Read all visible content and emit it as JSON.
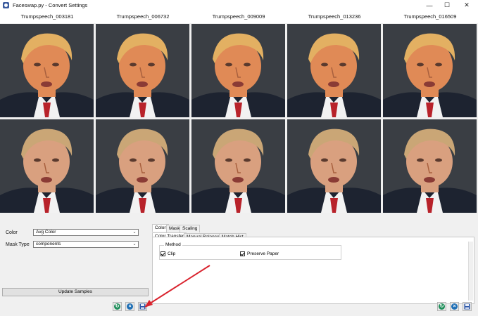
{
  "window": {
    "title": "Faceswap.py - Convert Settings",
    "controls": {
      "minimize": "—",
      "maximize": "☐",
      "close": "✕"
    }
  },
  "columns": [
    "Trumpspeech_003181",
    "Trumpspeech_006732",
    "Trumpspeech_009009",
    "Trumpspeech_013236",
    "Trumpspeech_016509"
  ],
  "grid": {
    "rows": [
      "original-face",
      "swapped-face"
    ],
    "colors": {
      "background": "#3a3e44",
      "suit": "#1d2330",
      "shirt": "#f2f2f2",
      "tie": "#b8222a",
      "hair_original": "#e3b062",
      "hair_swapped": "#caa676",
      "skin_original": "#e08a56",
      "skin_swapped": "#d9a07f"
    }
  },
  "settings": {
    "color": {
      "label": "Color",
      "value": "Avg Color"
    },
    "mask_type": {
      "label": "Mask Type",
      "value": "components"
    },
    "update_button": "Update Samples"
  },
  "tabs": {
    "top": [
      "Color",
      "Mask",
      "Scaling"
    ],
    "sub": [
      "Color Transfer",
      "Manual Balance",
      "Match Hist"
    ]
  },
  "method": {
    "title": "Method",
    "options": [
      {
        "label": "Clip",
        "checked": true
      },
      {
        "label": "Preserve Paper",
        "checked": true
      }
    ]
  },
  "actions": {
    "colors": {
      "refresh": "#1e8e5a",
      "reset": "#1f6fb5",
      "save": "#2a56a8"
    },
    "icons": [
      "refresh-icon",
      "reset-icon",
      "save-icon"
    ]
  },
  "annotation": {
    "arrow_color": "#d9232e"
  }
}
